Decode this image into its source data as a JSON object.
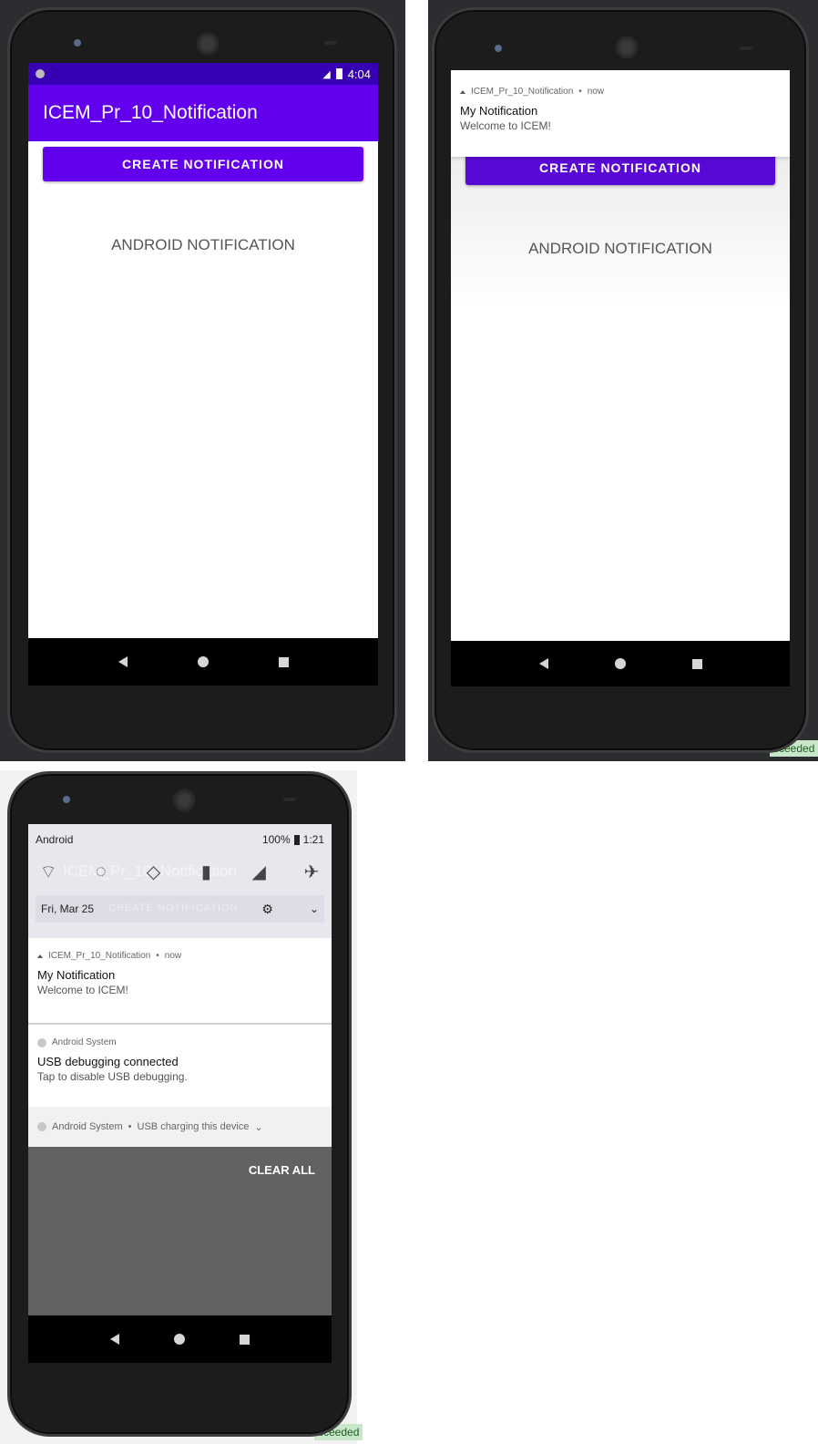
{
  "screens": [
    {
      "statusbar": {
        "time": "4:04"
      },
      "appbar_title": "ICEM_Pr_10_Notification",
      "button_label": "CREATE NOTIFICATION",
      "center_text": "ANDROID NOTIFICATION"
    },
    {
      "notification": {
        "app": "ICEM_Pr_10_Notification",
        "time": "now",
        "title": "My Notification",
        "body": "Welcome to ICEM!"
      },
      "button_label": "CREATE NOTIFICATION",
      "center_text": "ANDROID NOTIFICATION"
    },
    {
      "statusbar": {
        "carrier": "Android",
        "battery": "100%",
        "time": "1:21"
      },
      "quick_settings": {
        "date": "Fri, Mar 25",
        "icons": [
          "wifi-off-icon",
          "data-saver-icon",
          "rotate-icon",
          "battery-saver-icon",
          "lte-signal-icon",
          "airplane-mode-icon"
        ],
        "ghost_title": "ICEM_Pr_10_Notification",
        "ghost_button": "CREATE NOTIFICATION"
      },
      "notifications": [
        {
          "app": "ICEM_Pr_10_Notification",
          "time": "now",
          "title": "My Notification",
          "body": "Welcome to ICEM!"
        },
        {
          "app": "Android System",
          "title": "USB debugging connected",
          "body": "Tap to disable USB debugging."
        },
        {
          "app": "Android System",
          "summary": "USB charging this device"
        }
      ],
      "clear_all": "CLEAR ALL"
    }
  ],
  "ide": {
    "succeeded": "cceeded",
    "succeeded2": "cceeded"
  },
  "colors": {
    "accent": "#6200ee",
    "navbar": "#000000",
    "shade": "#626262"
  }
}
